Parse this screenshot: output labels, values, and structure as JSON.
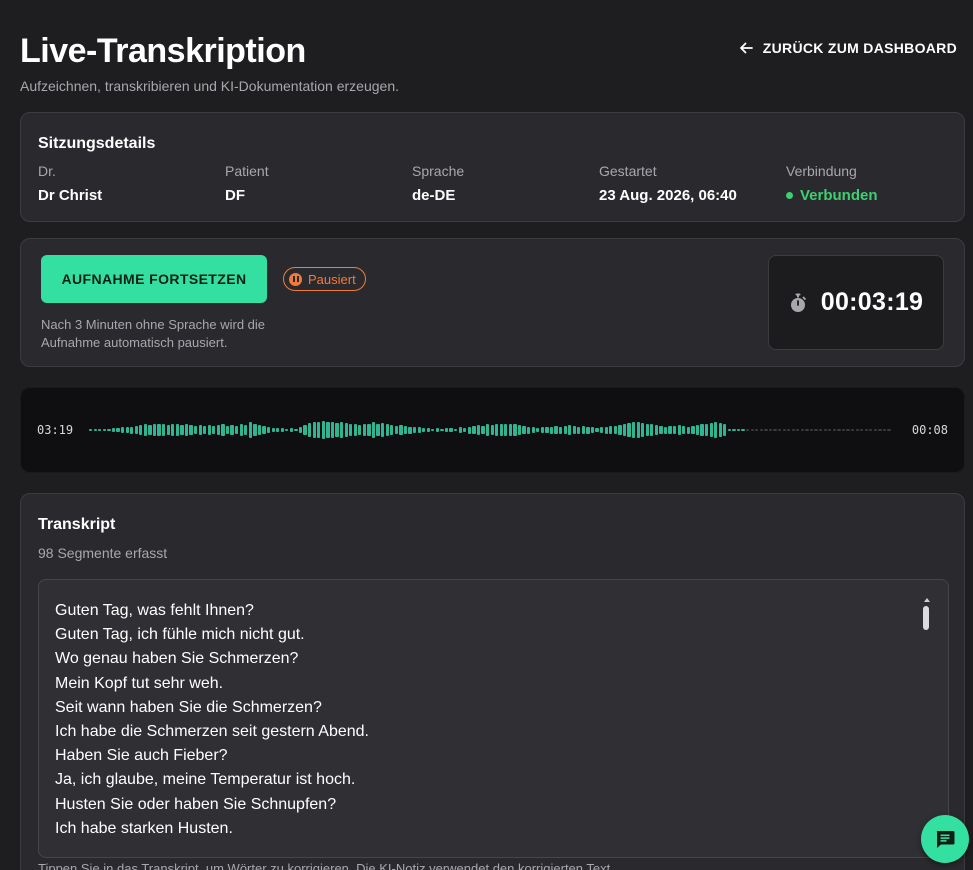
{
  "header": {
    "title": "Live-Transkription",
    "subtitle": "Aufzeichnen, transkribieren und KI-Dokumentation erzeugen.",
    "back_label": "ZURÜCK ZUM DASHBOARD"
  },
  "session": {
    "title": "Sitzungsdetails",
    "doctor": {
      "label": "Dr.",
      "value": "Dr Christ"
    },
    "patient": {
      "label": "Patient",
      "value": "DF"
    },
    "language": {
      "label": "Sprache",
      "value": "de-DE"
    },
    "started": {
      "label": "Gestartet",
      "value": "23 Aug. 2026, 06:40"
    },
    "connection": {
      "label": "Verbindung",
      "value": "Verbunden"
    }
  },
  "recording": {
    "resume_label": "AUFNAHME FORTSETZEN",
    "status_badge": "Pausiert",
    "hint": "Nach 3 Minuten ohne Sprache wird die Aufnahme automatisch pausiert.",
    "timer": "00:03:19"
  },
  "waveform": {
    "time_left": "03:19",
    "time_right": "00:08",
    "levels": [
      0.1,
      0.1,
      0.1,
      0.1,
      0.1,
      0.15,
      0.15,
      0.2,
      0.2,
      0.25,
      0.3,
      0.35,
      0.4,
      0.35,
      0.45,
      0.45,
      0.4,
      0.35,
      0.4,
      0.4,
      0.35,
      0.4,
      0.35,
      0.3,
      0.35,
      0.3,
      0.35,
      0.3,
      0.35,
      0.4,
      0.3,
      0.35,
      0.3,
      0.45,
      0.35,
      0.55,
      0.45,
      0.35,
      0.3,
      0.2,
      0.15,
      0.15,
      0.15,
      0.1,
      0.15,
      0.1,
      0.2,
      0.35,
      0.5,
      0.6,
      0.55,
      0.65,
      0.6,
      0.55,
      0.5,
      0.55,
      0.5,
      0.45,
      0.4,
      0.35,
      0.4,
      0.4,
      0.6,
      0.45,
      0.5,
      0.4,
      0.35,
      0.3,
      0.35,
      0.3,
      0.25,
      0.2,
      0.2,
      0.15,
      0.15,
      0.1,
      0.15,
      0.1,
      0.15,
      0.15,
      0.1,
      0.2,
      0.15,
      0.25,
      0.3,
      0.35,
      0.3,
      0.4,
      0.35,
      0.4,
      0.45,
      0.4,
      0.45,
      0.4,
      0.35,
      0.3,
      0.25,
      0.2,
      0.15,
      0.2,
      0.2,
      0.25,
      0.3,
      0.25,
      0.3,
      0.35,
      0.3,
      0.25,
      0.3,
      0.25,
      0.2,
      0.15,
      0.2,
      0.25,
      0.3,
      0.3,
      0.35,
      0.45,
      0.5,
      0.55,
      0.6,
      0.5,
      0.45,
      0.4,
      0.35,
      0.3,
      0.25,
      0.3,
      0.3,
      0.35,
      0.3,
      0.25,
      0.3,
      0.35,
      0.4,
      0.45,
      0.5,
      0.55,
      0.5,
      0.45,
      0.1,
      0.1,
      0.1,
      0.1,
      0.1,
      0.1,
      0.1,
      0.1,
      0.1,
      0.1,
      0.1,
      0.1,
      0.1,
      0.1,
      0.1,
      0.1,
      0.1,
      0.1,
      0.1,
      0.1,
      0.1,
      0.1,
      0.1,
      0.1,
      0.1,
      0.1,
      0.1,
      0.1,
      0.1,
      0.1,
      0.1,
      0.1,
      0.1,
      0.1,
      0.1,
      0.1
    ],
    "played_fraction": 0.82
  },
  "transcript": {
    "title": "Transkript",
    "count": "98 Segmente erfasst",
    "lines": [
      "Guten Tag, was fehlt Ihnen?",
      "Guten Tag, ich fühle mich nicht gut.",
      "Wo genau haben Sie Schmerzen?",
      "Mein Kopf tut sehr weh.",
      "Seit wann haben Sie die Schmerzen?",
      "Ich habe die Schmerzen seit gestern Abend.",
      "Haben Sie auch Fieber?",
      "Ja, ich glaube, meine Temperatur ist hoch.",
      "Husten Sie oder haben Sie Schnupfen?",
      "Ich habe starken Husten."
    ],
    "footer": "Tippen Sie in das Transkript, um Wörter zu korrigieren. Die KI-Notiz verwendet den korrigierten Text."
  },
  "colors": {
    "accent": "#33dfa1",
    "paused": "#f27a3b",
    "connected": "#3ecf72",
    "wave_active": "#2fb592",
    "wave_inactive": "#3a3a40"
  },
  "icons": {
    "back": "arrow-left-icon",
    "timer": "stopwatch-icon",
    "pause": "pause-icon",
    "chat": "chat-icon"
  }
}
